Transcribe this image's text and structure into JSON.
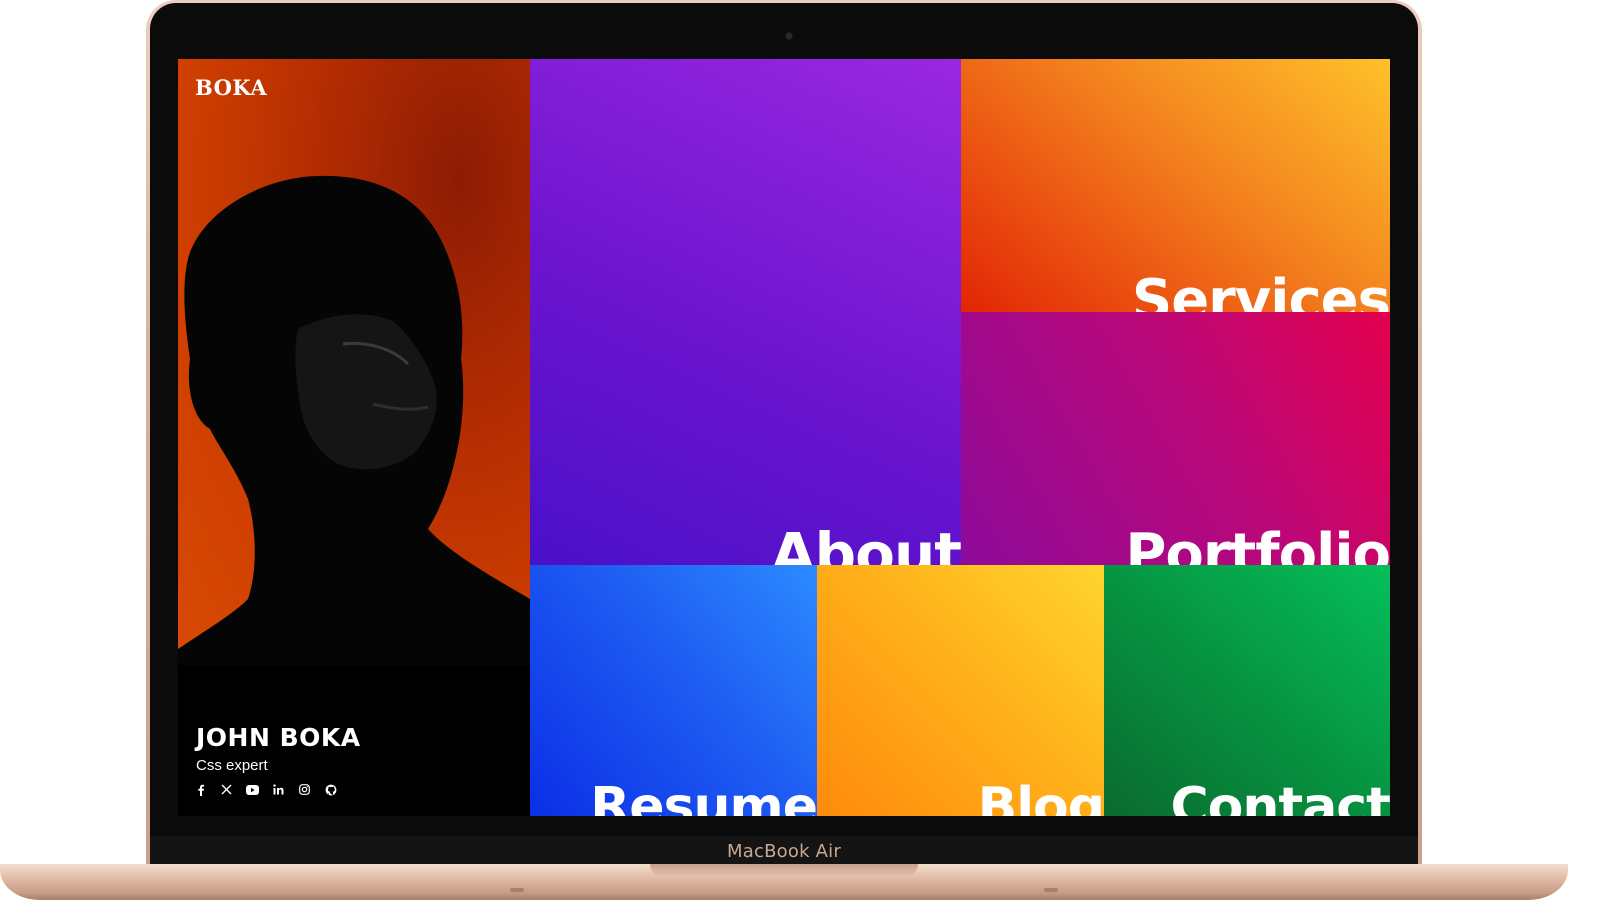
{
  "device": {
    "label": "MacBook Air"
  },
  "brand": {
    "logo": "BOKA"
  },
  "profile": {
    "name": "JOHN BOKA",
    "role": "Css expert",
    "socials": [
      {
        "icon": "facebook-icon",
        "glyph": "f"
      },
      {
        "icon": "x-icon",
        "glyph": "𝕏"
      },
      {
        "icon": "youtube-icon",
        "glyph": ""
      },
      {
        "icon": "linkedin-icon",
        "glyph": "in"
      },
      {
        "icon": "instagram-icon",
        "glyph": ""
      },
      {
        "icon": "github-icon",
        "glyph": ""
      }
    ]
  },
  "tiles": {
    "about": "About",
    "services": "Services",
    "portfolio": "Portfolio",
    "resume": "Resume",
    "blog": "Blog",
    "contact": "Contact"
  },
  "colors": {
    "about": "#6d14cf",
    "services": "#f4871f",
    "portfolio": "#b8087a",
    "resume": "#1e5cf2",
    "blog": "#ffb11a",
    "contact": "#069441",
    "portrait_bg": "#cf3f00"
  }
}
